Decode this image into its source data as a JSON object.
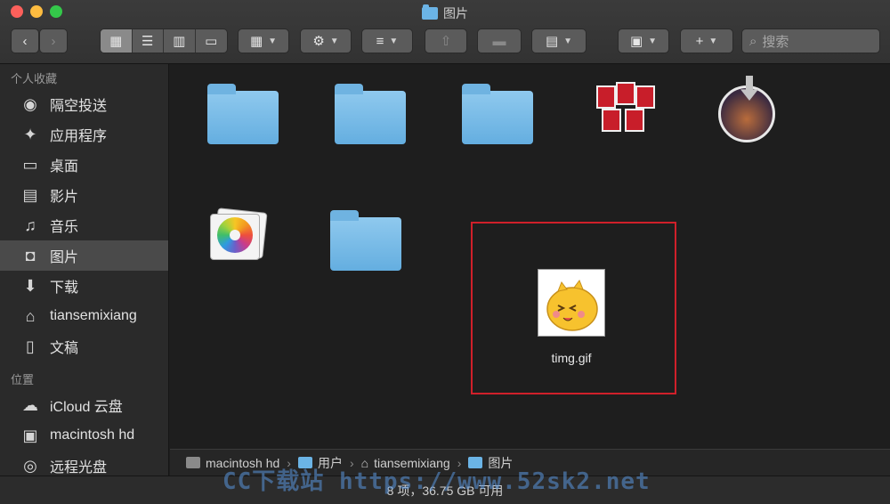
{
  "window": {
    "title": "图片"
  },
  "toolbar": {
    "search_placeholder": "搜索"
  },
  "sidebar": {
    "favorites_header": "个人收藏",
    "favorites": [
      {
        "label": "隔空投送",
        "icon": "airdrop-icon"
      },
      {
        "label": "应用程序",
        "icon": "applications-icon"
      },
      {
        "label": "桌面",
        "icon": "desktop-icon"
      },
      {
        "label": "影片",
        "icon": "movies-icon"
      },
      {
        "label": "音乐",
        "icon": "music-icon"
      },
      {
        "label": "图片",
        "icon": "pictures-icon",
        "selected": true
      },
      {
        "label": "下载",
        "icon": "downloads-icon"
      },
      {
        "label": "tiansemixiang",
        "icon": "home-icon"
      },
      {
        "label": "文稿",
        "icon": "documents-icon"
      }
    ],
    "locations_header": "位置",
    "locations": [
      {
        "label": "iCloud 云盘",
        "icon": "icloud-icon"
      },
      {
        "label": "macintosh hd",
        "icon": "harddisk-icon"
      },
      {
        "label": "远程光盘",
        "icon": "remote-disc-icon"
      }
    ]
  },
  "files": {
    "highlighted": {
      "name": "timg.gif"
    }
  },
  "pathbar": {
    "crumbs": [
      "macintosh hd",
      "用户",
      "tiansemixiang",
      "图片"
    ]
  },
  "status": {
    "text": "8 项，36.75 GB 可用"
  },
  "watermark": {
    "text": "CC下载站 https://www.52sk2.net"
  },
  "colors": {
    "accent_highlight": "#d0202a",
    "folder_blue": "#64aee0"
  }
}
